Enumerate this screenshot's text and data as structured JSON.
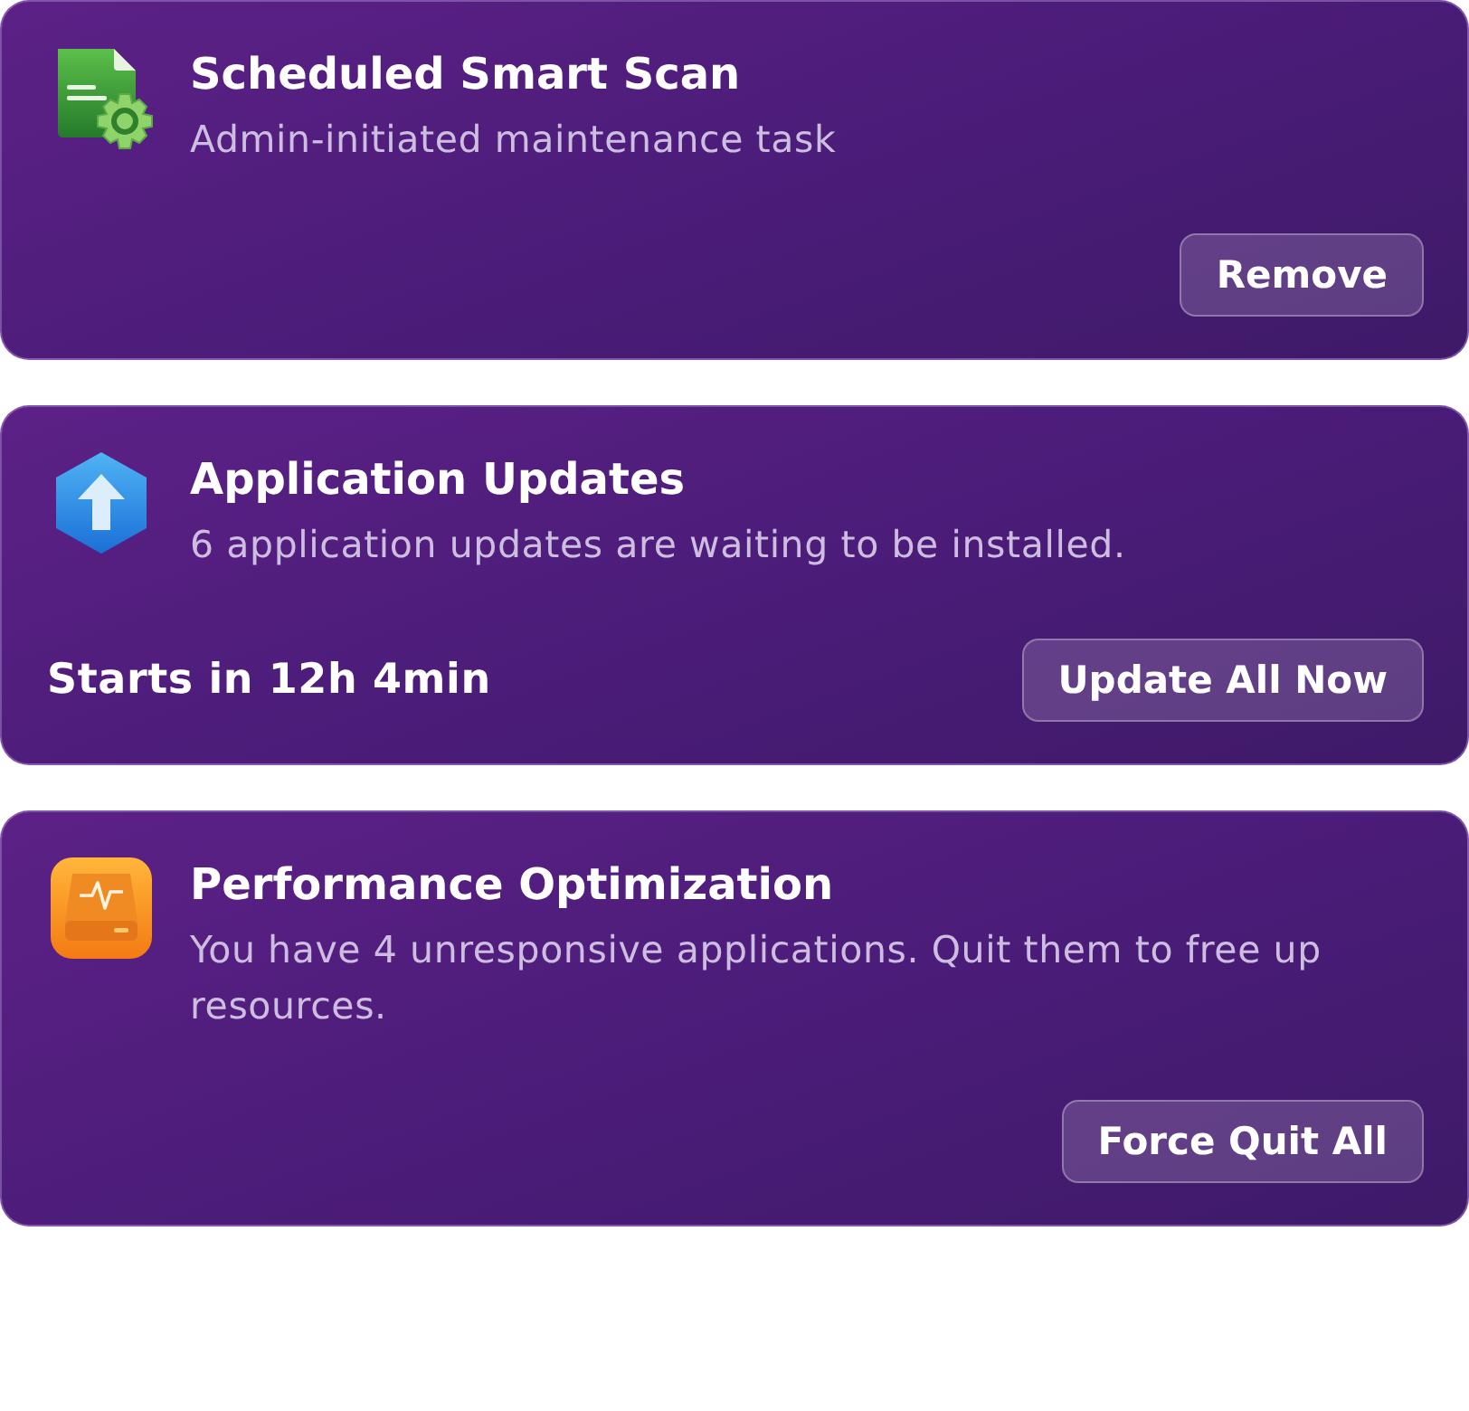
{
  "cards": [
    {
      "kind": "scan",
      "title": "Scheduled Smart Scan",
      "description": "Admin-initiated maintenance task",
      "button": "Remove"
    },
    {
      "kind": "update",
      "title": "Application Updates",
      "description": "6 application updates are waiting to be installed.",
      "footer_text": "Starts in 12h 4min",
      "button": "Update All Now"
    },
    {
      "kind": "performance",
      "title": "Performance Optimization",
      "description": "You have 4 unresponsive applications. Quit them to free up resources.",
      "button": "Force Quit All"
    }
  ]
}
